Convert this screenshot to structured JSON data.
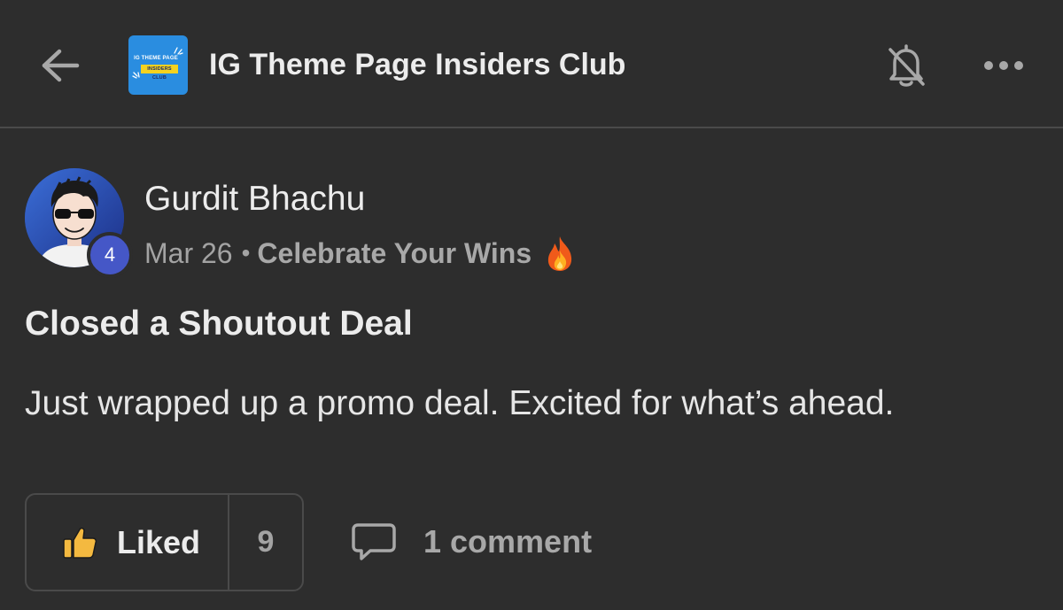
{
  "header": {
    "back_icon": "arrow-left-icon",
    "group_logo": {
      "line1": "IG THEME PAGE",
      "line2": "INSIDERS CLUB"
    },
    "group_title": "IG Theme Page Insiders Club",
    "bell_icon": "bell-off-icon",
    "more_icon": "more-horizontal-icon"
  },
  "post": {
    "author": {
      "name": "Gurdit Bhachu",
      "level": "4"
    },
    "date": "Mar 26",
    "separator": "•",
    "category": "Celebrate Your Wins",
    "category_icon": "fire-icon",
    "title": "Closed a Shoutout Deal",
    "body": "Just wrapped up a promo deal. Excited for what’s ahead.",
    "actions": {
      "like_icon": "thumbs-up-icon",
      "like_label": "Liked",
      "like_count": "9",
      "comment_icon": "comment-icon",
      "comment_label": "1 comment"
    }
  },
  "colors": {
    "background": "#2d2d2d",
    "divider": "#4a4a4a",
    "level_badge": "#4557c7",
    "logo_blue": "#2a8de0",
    "logo_yellow": "#f4d21f",
    "like_thumb": "#f4b940"
  }
}
